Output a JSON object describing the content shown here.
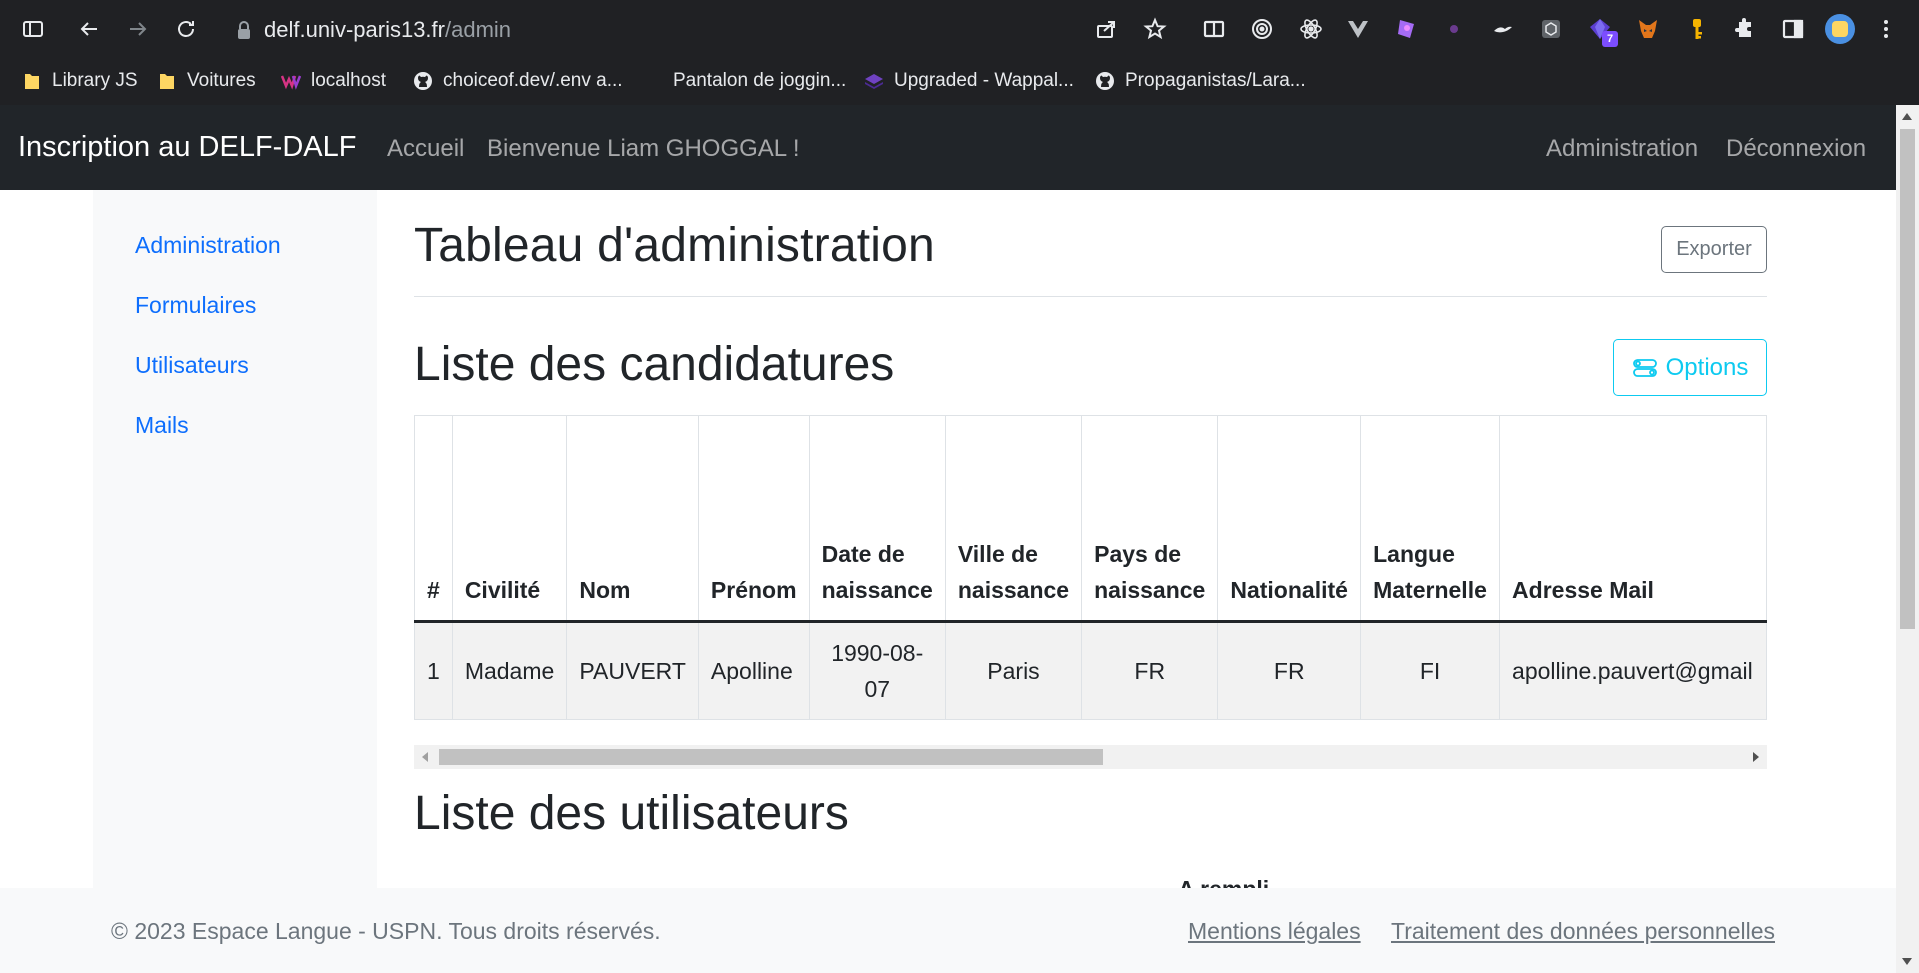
{
  "browser": {
    "url_host": "delf.univ-paris13.fr",
    "url_path": "/admin",
    "extension_badge": "7",
    "bookmarks": [
      {
        "label": "Library JS",
        "icon": "folder-icon"
      },
      {
        "label": "Voitures",
        "icon": "folder-icon"
      },
      {
        "label": "localhost",
        "icon": "wappalyzer-icon"
      },
      {
        "label": "choiceof.dev/.env a...",
        "icon": "github-icon"
      },
      {
        "label": "Pantalon de joggin...",
        "icon": "blank-page-icon"
      },
      {
        "label": "Upgraded - Wappal...",
        "icon": "stack-icon"
      },
      {
        "label": "Propaganistas/Lara...",
        "icon": "github-icon"
      }
    ]
  },
  "nav": {
    "brand": "Inscription au DELF-DALF",
    "home": "Accueil",
    "welcome": "Bienvenue Liam GHOGGAL !",
    "admin": "Administration",
    "logout": "Déconnexion"
  },
  "sidebar": {
    "items": [
      "Administration",
      "Formulaires",
      "Utilisateurs",
      "Mails"
    ]
  },
  "main": {
    "title": "Tableau d'administration",
    "export_label": "Exporter",
    "candidatures_title": "Liste des candidatures",
    "options_label": "Options",
    "users_title": "Liste des utilisateurs",
    "users_partial_header": "A rempli"
  },
  "table": {
    "headers": [
      [
        "#"
      ],
      [
        "Civilité"
      ],
      [
        "Nom"
      ],
      [
        "Prénom"
      ],
      [
        "Date de",
        "naissance"
      ],
      [
        "Ville de",
        "naissance"
      ],
      [
        "Pays de",
        "naissance"
      ],
      [
        "Nationalité"
      ],
      [
        "Langue",
        "Maternelle"
      ],
      [
        "Adresse Mail"
      ]
    ],
    "rows": [
      {
        "num": "1",
        "civilite": "Madame",
        "nom": "PAUVERT",
        "prenom": "Apolline",
        "date_l1": "1990-08-",
        "date_l2": "07",
        "ville": "Paris",
        "pays": "FR",
        "nationalite": "FR",
        "langue": "FI",
        "email": "apolline.pauvert@gmail"
      }
    ]
  },
  "footer": {
    "copyright": "© 2023 Espace Langue - USPN. Tous droits réservés.",
    "legal": "Mentions légales",
    "privacy": "Traitement des données personnelles"
  },
  "colors": {
    "nav_bg": "#212529",
    "link": "#0d6efd",
    "info": "#0dcaf0",
    "secondary": "#6c757d"
  }
}
